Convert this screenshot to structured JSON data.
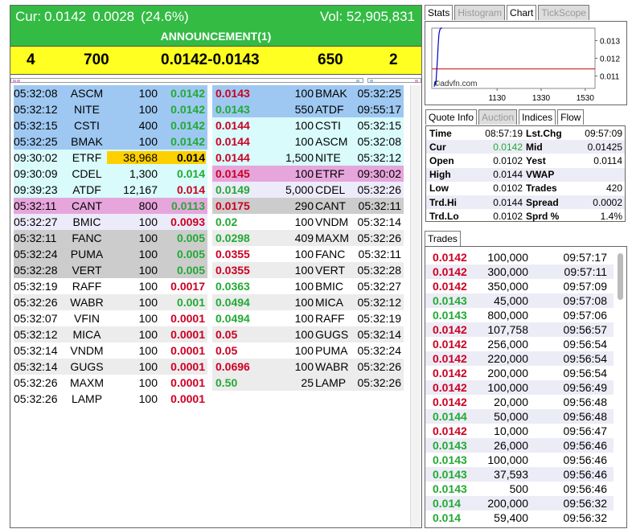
{
  "header": {
    "cur_label": "Cur:",
    "cur_price": "0.0142",
    "change": "0.0028",
    "change_pct": "(24.6%)",
    "volume": "Vol: 52,905,831",
    "announcement": "ANNOUNCEMENT(1)"
  },
  "summary": {
    "bid_count": "4",
    "bid_volume": "700",
    "spread": "0.0142-0.0143",
    "ask_volume": "650",
    "ask_count": "2"
  },
  "colors": {
    "header_green": "#33bb44",
    "summary_yellow": "#ffff22",
    "up": "#22aa33",
    "down": "#cc0022",
    "highlight": "#ffd000"
  },
  "bids": [
    {
      "time": "05:32:08",
      "code": "ASCM",
      "vol": "100",
      "price": "0.0142",
      "dir": "up",
      "bg": "blue"
    },
    {
      "time": "05:32:12",
      "code": "NITE",
      "vol": "100",
      "price": "0.0142",
      "dir": "up",
      "bg": "blue"
    },
    {
      "time": "05:32:15",
      "code": "CSTI",
      "vol": "400",
      "price": "0.0142",
      "dir": "up",
      "bg": "blue"
    },
    {
      "time": "05:32:25",
      "code": "BMAK",
      "vol": "100",
      "price": "0.0142",
      "dir": "up",
      "bg": "blue"
    },
    {
      "time": "09:30:02",
      "code": "ETRF",
      "vol": "38,968",
      "price": "0.014",
      "dir": "none",
      "bg": "cyan",
      "hl": true
    },
    {
      "time": "09:30:09",
      "code": "CDEL",
      "vol": "1,300",
      "price": "0.014",
      "dir": "up",
      "bg": "cyan"
    },
    {
      "time": "09:39:23",
      "code": "ATDF",
      "vol": "12,167",
      "price": "0.014",
      "dir": "dn",
      "bg": "cyan"
    },
    {
      "time": "05:32:11",
      "code": "CANT",
      "vol": "800",
      "price": "0.0113",
      "dir": "up",
      "bg": "pink"
    },
    {
      "time": "05:32:27",
      "code": "BMIC",
      "vol": "100",
      "price": "0.0093",
      "dir": "dn",
      "bg": "lav"
    },
    {
      "time": "05:32:11",
      "code": "FANC",
      "vol": "100",
      "price": "0.005",
      "dir": "up",
      "bg": "gray"
    },
    {
      "time": "05:32:24",
      "code": "PUMA",
      "vol": "100",
      "price": "0.005",
      "dir": "up",
      "bg": "gray"
    },
    {
      "time": "05:32:28",
      "code": "VERT",
      "vol": "100",
      "price": "0.005",
      "dir": "up",
      "bg": "gray"
    },
    {
      "time": "05:32:19",
      "code": "RAFF",
      "vol": "100",
      "price": "0.0017",
      "dir": "dn",
      "bg": "none"
    },
    {
      "time": "05:32:26",
      "code": "WABR",
      "vol": "100",
      "price": "0.001",
      "dir": "up",
      "bg": "lgray"
    },
    {
      "time": "05:32:07",
      "code": "VFIN",
      "vol": "100",
      "price": "0.0001",
      "dir": "dn",
      "bg": "none"
    },
    {
      "time": "05:32:12",
      "code": "MICA",
      "vol": "100",
      "price": "0.0001",
      "dir": "dn",
      "bg": "lgray"
    },
    {
      "time": "05:32:14",
      "code": "VNDM",
      "vol": "100",
      "price": "0.0001",
      "dir": "dn",
      "bg": "none"
    },
    {
      "time": "05:32:14",
      "code": "GUGS",
      "vol": "100",
      "price": "0.0001",
      "dir": "dn",
      "bg": "lgray"
    },
    {
      "time": "05:32:26",
      "code": "MAXM",
      "vol": "100",
      "price": "0.0001",
      "dir": "dn",
      "bg": "none"
    },
    {
      "time": "05:32:26",
      "code": "LAMP",
      "vol": "100",
      "price": "0.0001",
      "dir": "dn",
      "bg": "none"
    }
  ],
  "asks": [
    {
      "price": "0.0143",
      "vol": "100",
      "code": "BMAK",
      "time": "05:32:25",
      "dir": "dn",
      "bg": "blue"
    },
    {
      "price": "0.0143",
      "vol": "550",
      "code": "ATDF",
      "time": "09:55:17",
      "dir": "up",
      "bg": "blue"
    },
    {
      "price": "0.0144",
      "vol": "100",
      "code": "CSTI",
      "time": "05:32:15",
      "dir": "dn",
      "bg": "cyan"
    },
    {
      "price": "0.0144",
      "vol": "100",
      "code": "ASCM",
      "time": "05:32:08",
      "dir": "dn",
      "bg": "cyan"
    },
    {
      "price": "0.0144",
      "vol": "1,500",
      "code": "NITE",
      "time": "05:32:12",
      "dir": "dn",
      "bg": "cyan"
    },
    {
      "price": "0.0145",
      "vol": "100",
      "code": "ETRF",
      "time": "09:30:02",
      "dir": "dn",
      "bg": "pink"
    },
    {
      "price": "0.0149",
      "vol": "5,000",
      "code": "CDEL",
      "time": "05:32:26",
      "dir": "up",
      "bg": "lav"
    },
    {
      "price": "0.0175",
      "vol": "290",
      "code": "CANT",
      "time": "05:32:11",
      "dir": "dn",
      "bg": "gray"
    },
    {
      "price": "0.02",
      "vol": "100",
      "code": "VNDM",
      "time": "05:32:14",
      "dir": "up",
      "bg": "none"
    },
    {
      "price": "0.0298",
      "vol": "409",
      "code": "MAXM",
      "time": "05:32:26",
      "dir": "up",
      "bg": "lgray"
    },
    {
      "price": "0.0355",
      "vol": "100",
      "code": "FANC",
      "time": "05:32:11",
      "dir": "dn",
      "bg": "none"
    },
    {
      "price": "0.0355",
      "vol": "100",
      "code": "VERT",
      "time": "05:32:28",
      "dir": "dn",
      "bg": "lgray"
    },
    {
      "price": "0.0363",
      "vol": "100",
      "code": "BMIC",
      "time": "05:32:27",
      "dir": "up",
      "bg": "none"
    },
    {
      "price": "0.0494",
      "vol": "100",
      "code": "MICA",
      "time": "05:32:12",
      "dir": "up",
      "bg": "lgray"
    },
    {
      "price": "0.0494",
      "vol": "100",
      "code": "RAFF",
      "time": "05:32:19",
      "dir": "up",
      "bg": "none"
    },
    {
      "price": "0.05",
      "vol": "100",
      "code": "GUGS",
      "time": "05:32:14",
      "dir": "dn",
      "bg": "lgray"
    },
    {
      "price": "0.05",
      "vol": "100",
      "code": "PUMA",
      "time": "05:32:24",
      "dir": "dn",
      "bg": "none"
    },
    {
      "price": "0.0696",
      "vol": "100",
      "code": "WABR",
      "time": "05:32:26",
      "dir": "dn",
      "bg": "lgray"
    },
    {
      "price": "0.50",
      "vol": "25",
      "code": "LAMP",
      "time": "05:32:26",
      "dir": "up",
      "bg": "lgray"
    }
  ],
  "chart_tabs": [
    {
      "label": "Stats",
      "state": "on"
    },
    {
      "label": "Histogram",
      "state": "off"
    },
    {
      "label": "Chart",
      "state": "on"
    },
    {
      "label": "TickScope",
      "state": "off"
    }
  ],
  "chart_data": {
    "type": "line",
    "x_ticks": [
      "1130",
      "1330",
      "1530"
    ],
    "y_ticks": [
      "0.013",
      "0.012",
      "0.011"
    ],
    "ylim": [
      0.0103,
      0.0137
    ],
    "reference_line": 0.0114,
    "watermark": "©advfn.com",
    "series": [
      {
        "values": [
          0.0104,
          0.0107,
          0.0105,
          0.0112,
          0.0119,
          0.0128,
          0.0134,
          0.0136,
          0.0137
        ]
      }
    ]
  },
  "quote_tabs": [
    {
      "label": "Quote Info",
      "state": "on"
    },
    {
      "label": "Auction",
      "state": "off"
    },
    {
      "label": "Indices",
      "state": "on"
    },
    {
      "label": "Flow",
      "state": "on"
    }
  ],
  "quote": [
    {
      "l1": "Time",
      "v1": "08:57:19",
      "c1": "",
      "l2": "Lst.Chg",
      "v2": "09:57:09"
    },
    {
      "l1": "Cur",
      "v1": "0.0142",
      "c1": "up",
      "l2": "Mid",
      "v2": "0.01425"
    },
    {
      "l1": "Open",
      "v1": "0.0102",
      "c1": "",
      "l2": "Yest",
      "v2": "0.0114"
    },
    {
      "l1": "High",
      "v1": "0.0144",
      "c1": "",
      "l2": "VWAP",
      "v2": ""
    },
    {
      "l1": "Low",
      "v1": "0.0102",
      "c1": "",
      "l2": "Trades",
      "v2": "420"
    },
    {
      "l1": "Trd.Hi",
      "v1": "0.0144",
      "c1": "",
      "l2": "Spread",
      "v2": "0.0002"
    },
    {
      "l1": "Trd.Lo",
      "v1": "0.0102",
      "c1": "",
      "l2": "Sprd %",
      "v2": "1.4%"
    }
  ],
  "trades_tab": "Trades",
  "trades": [
    {
      "p": "0.0142",
      "v": "100,000",
      "t": "09:57:17",
      "d": "dn"
    },
    {
      "p": "0.0142",
      "v": "300,000",
      "t": "09:57:11",
      "d": "dn"
    },
    {
      "p": "0.0142",
      "v": "350,000",
      "t": "09:57:09",
      "d": "dn"
    },
    {
      "p": "0.0143",
      "v": "45,000",
      "t": "09:57:08",
      "d": "up"
    },
    {
      "p": "0.0143",
      "v": "800,000",
      "t": "09:57:06",
      "d": "up"
    },
    {
      "p": "0.0142",
      "v": "107,758",
      "t": "09:56:57",
      "d": "dn"
    },
    {
      "p": "0.0142",
      "v": "256,000",
      "t": "09:56:54",
      "d": "dn"
    },
    {
      "p": "0.0142",
      "v": "220,000",
      "t": "09:56:54",
      "d": "dn"
    },
    {
      "p": "0.0142",
      "v": "200,000",
      "t": "09:56:54",
      "d": "dn"
    },
    {
      "p": "0.0142",
      "v": "100,000",
      "t": "09:56:49",
      "d": "dn"
    },
    {
      "p": "0.0142",
      "v": "20,000",
      "t": "09:56:48",
      "d": "dn"
    },
    {
      "p": "0.0144",
      "v": "50,000",
      "t": "09:56:48",
      "d": "up"
    },
    {
      "p": "0.0142",
      "v": "10,000",
      "t": "09:56:47",
      "d": "dn"
    },
    {
      "p": "0.0143",
      "v": "26,000",
      "t": "09:56:46",
      "d": "up"
    },
    {
      "p": "0.0143",
      "v": "100,000",
      "t": "09:56:46",
      "d": "up"
    },
    {
      "p": "0.0143",
      "v": "37,593",
      "t": "09:56:46",
      "d": "up"
    },
    {
      "p": "0.0143",
      "v": "500",
      "t": "09:56:46",
      "d": "up"
    },
    {
      "p": "0.014",
      "v": "200,000",
      "t": "09:56:32",
      "d": "up"
    },
    {
      "p": "0.014",
      "v": "59,400",
      "t": "09:56:32",
      "d": "up"
    }
  ]
}
